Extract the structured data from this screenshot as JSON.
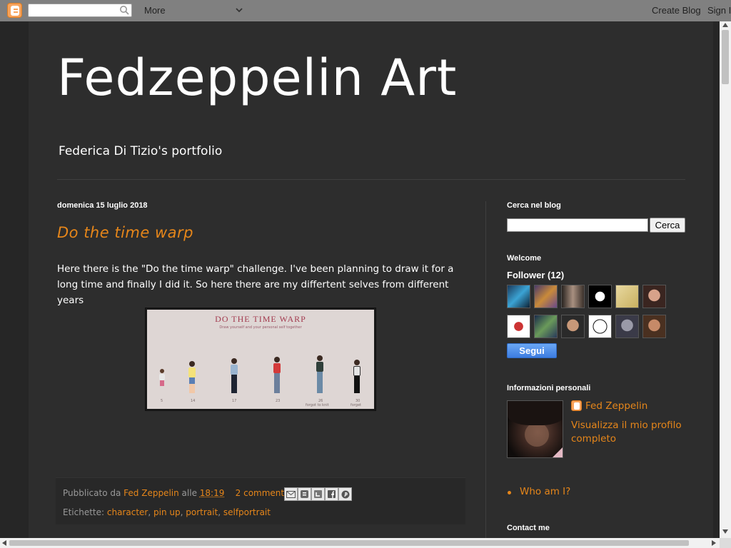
{
  "navbar": {
    "more_label": "More",
    "create_blog": "Create Blog",
    "sign_in": "Sign In"
  },
  "header": {
    "title": "Fedzeppelin Art",
    "description": "Federica Di Tizio's portfolio"
  },
  "post": {
    "date": "domenica 15 luglio 2018",
    "title": "Do the time warp",
    "body": "Here there is the \"Do the time warp\" challenge. I've been planning to draw it for a long time and finally I did it. So here there are my differtent selves from different years",
    "image": {
      "heading": "DO THE TIME WARP",
      "subheading": "Draw yourself and your personal self together",
      "ages": [
        "5",
        "14",
        "17",
        "23",
        "26",
        "30"
      ],
      "age_captions": [
        "",
        "",
        "",
        "",
        "forgot to knit",
        "forget"
      ]
    },
    "footer": {
      "published_by": "Pubblicato da",
      "author": "Fed Zeppelin",
      "at": "alle",
      "time": "18:19",
      "comments": "2 commenti:",
      "labels_prefix": "Etichette:",
      "labels": [
        "character",
        "pin up",
        "portrait",
        "selfportrait"
      ],
      "share_buttons": [
        "email-icon",
        "blogger-icon",
        "twitter-icon",
        "facebook-icon",
        "pinterest-icon"
      ]
    }
  },
  "sidebar": {
    "search_heading": "Cerca nel blog",
    "search_button": "Cerca",
    "welcome_heading": "Welcome",
    "followers_heading": "Follower (12)",
    "follow_button": "Segui",
    "profile_heading": "Informazioni personali",
    "profile_name": "Fed Zeppelin",
    "profile_link": "Visualizza il mio profilo completo",
    "pages": [
      "Who am I?"
    ],
    "contact_heading": "Contact me"
  },
  "colors": {
    "accent": "#e6861a",
    "background": "#2d2d2d",
    "outer": "#262626"
  }
}
